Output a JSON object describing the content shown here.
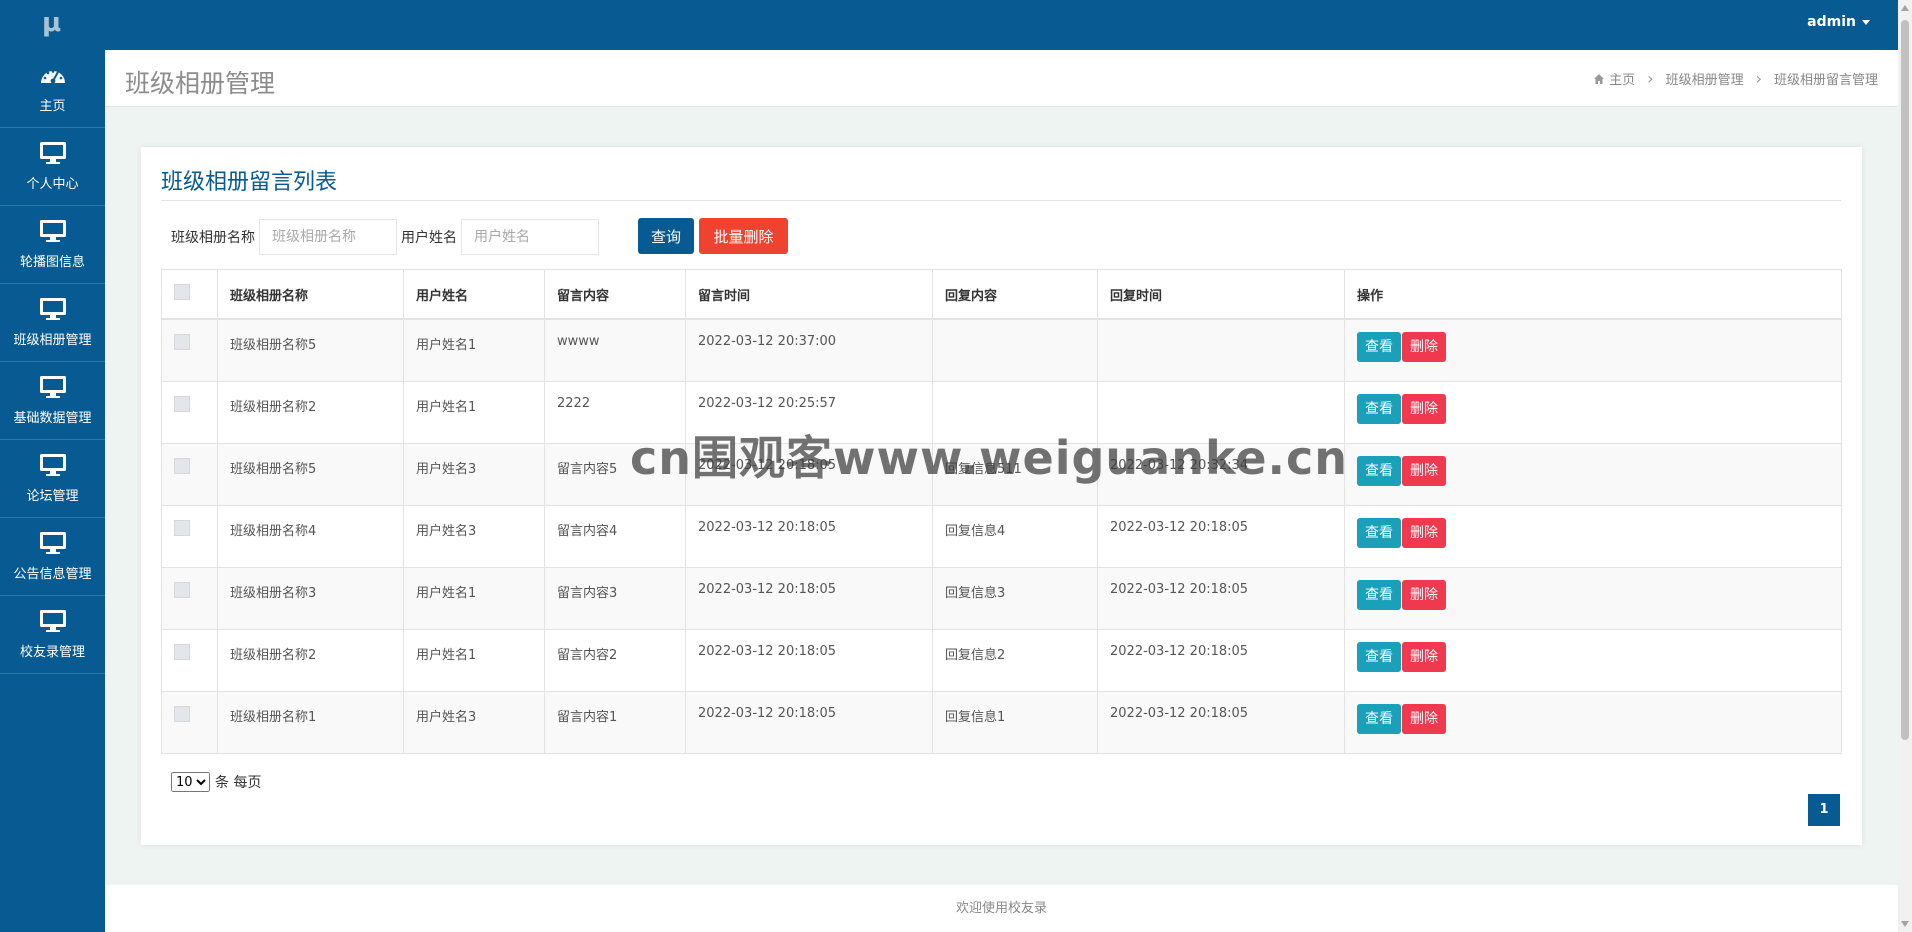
{
  "app": {
    "logo": "μ",
    "user": "admin"
  },
  "sidebar": {
    "items": [
      {
        "label": "主页",
        "icon": "dashboard-icon"
      },
      {
        "label": "个人中心",
        "icon": "monitor-icon"
      },
      {
        "label": "轮播图信息",
        "icon": "monitor-icon"
      },
      {
        "label": "班级相册管理",
        "icon": "monitor-icon"
      },
      {
        "label": "基础数据管理",
        "icon": "monitor-icon"
      },
      {
        "label": "论坛管理",
        "icon": "monitor-icon"
      },
      {
        "label": "公告信息管理",
        "icon": "monitor-icon"
      },
      {
        "label": "校友录管理",
        "icon": "monitor-icon"
      }
    ]
  },
  "header": {
    "title": "班级相册管理",
    "breadcrumb": [
      "主页",
      "班级相册管理",
      "班级相册留言管理"
    ]
  },
  "card": {
    "title": "班级相册留言列表",
    "filters": {
      "album_label": "班级相册名称",
      "album_placeholder": "班级相册名称",
      "user_label": "用户姓名",
      "user_placeholder": "用户姓名"
    },
    "query_label": "查询",
    "bulk_delete_label": "批量删除",
    "columns": [
      "班级相册名称",
      "用户姓名",
      "留言内容",
      "留言时间",
      "回复内容",
      "回复时间",
      "操作"
    ],
    "rows": [
      [
        "班级相册名称5",
        "用户姓名1",
        "wwww",
        "2022-03-12 20:37:00",
        "",
        ""
      ],
      [
        "班级相册名称2",
        "用户姓名1",
        "2222",
        "2022-03-12 20:25:57",
        "",
        ""
      ],
      [
        "班级相册名称5",
        "用户姓名3",
        "留言内容5",
        "2022-03-12 20:18:05",
        "回复信息511",
        "2022-03-12 20:32:34"
      ],
      [
        "班级相册名称4",
        "用户姓名3",
        "留言内容4",
        "2022-03-12 20:18:05",
        "回复信息4",
        "2022-03-12 20:18:05"
      ],
      [
        "班级相册名称3",
        "用户姓名1",
        "留言内容3",
        "2022-03-12 20:18:05",
        "回复信息3",
        "2022-03-12 20:18:05"
      ],
      [
        "班级相册名称2",
        "用户姓名1",
        "留言内容2",
        "2022-03-12 20:18:05",
        "回复信息2",
        "2022-03-12 20:18:05"
      ],
      [
        "班级相册名称1",
        "用户姓名3",
        "留言内容1",
        "2022-03-12 20:18:05",
        "回复信息1",
        "2022-03-12 20:18:05"
      ]
    ],
    "view_label": "查看",
    "delete_label": "删除",
    "page_size": "10",
    "page_size_suffix": "条 每页",
    "current_page": "1"
  },
  "footer": {
    "text": "欢迎使用校友录"
  },
  "watermark": "cn围观客www.weiguanke.cn",
  "colors": {
    "primary": "#075a92",
    "danger": "#f0432f",
    "info": "#1aa0b8"
  }
}
